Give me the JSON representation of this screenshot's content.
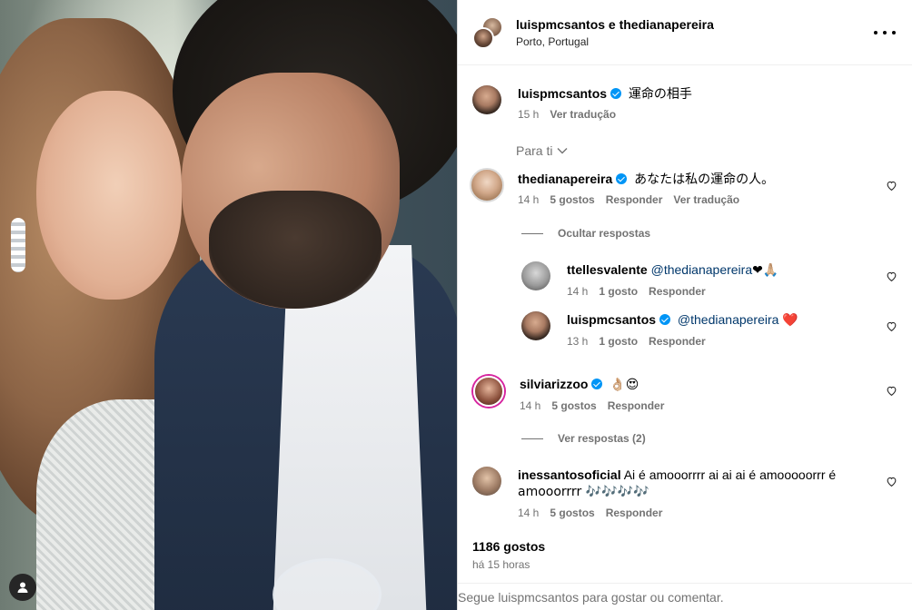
{
  "post": {
    "header_title": "luispmcsantos e thedianapereira",
    "location": "Porto, Portugal"
  },
  "caption": {
    "username": "luispmcsantos",
    "text": "運命の相手",
    "time": "15 h",
    "translate": "Ver tradução"
  },
  "filter_label": "Para ti",
  "comments": [
    {
      "username": "thedianapereira",
      "verified": true,
      "text": "あなたは私の運命の人。",
      "time": "14 h",
      "likes": "5 gostos",
      "reply": "Responder",
      "translate": "Ver tradução",
      "replies_toggle": "Ocultar respostas",
      "replies": [
        {
          "username": "ttellesvalente",
          "mention": "@thedianapereira",
          "emoji": "❤🙏🏼",
          "time": "14 h",
          "likes": "1 gosto",
          "reply": "Responder"
        },
        {
          "username": "luispmcsantos",
          "verified": true,
          "mention": "@thedianapereira",
          "emoji": "❤️",
          "time": "13 h",
          "likes": "1 gosto",
          "reply": "Responder"
        }
      ]
    },
    {
      "username": "silviarizzoo",
      "verified": true,
      "text": "👌🏼😍",
      "time": "14 h",
      "likes": "5 gostos",
      "reply": "Responder",
      "replies_toggle": "Ver respostas (2)"
    },
    {
      "username": "inessantosoficial",
      "text_line1": "Ai é amooorrrr ai ai ai é amooooorrr é",
      "text_line2": "amooorrrr 🎶🎶🎶🎶",
      "time": "14 h",
      "likes": "5 gostos",
      "reply": "Responder"
    }
  ],
  "likes_total": "1186 gostos",
  "posted_ago": "há 15 horas",
  "footer_prompt": "Segue luispmcsantos para gostar ou comentar.",
  "icons": {
    "more": "more-horizontal-icon",
    "heart": "heart-outline-icon",
    "user_tag": "user-tag-icon",
    "chevron": "chevron-down-icon",
    "verified": "verified-badge-icon"
  },
  "colors": {
    "verified_blue": "#0095f6",
    "mention": "#00376b",
    "secondary_text": "#737373",
    "story_ring": "#d6249f"
  }
}
